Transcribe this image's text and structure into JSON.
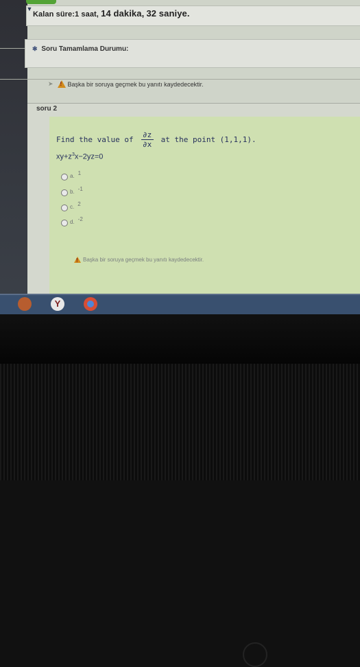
{
  "timer": {
    "label": "Kalan süre:1 saat,",
    "minutes": "14 dakika,",
    "seconds": "32 saniye."
  },
  "status": {
    "label": "Soru Tamamlama Durumu:"
  },
  "warning_top": {
    "text": "Başka bir soruya geçmek bu yanıtı kaydedecektir."
  },
  "question": {
    "label": "soru 2",
    "prefix": "Find the value of",
    "fraction_num": "∂z",
    "fraction_den": "∂x",
    "suffix": "at the point (1,1,1).",
    "equation_part1": "xy+z",
    "equation_exp": "3",
    "equation_part2": "x−2yz=0",
    "options": [
      {
        "letter": "a.",
        "value": "1"
      },
      {
        "letter": "b.",
        "value": "-1"
      },
      {
        "letter": "c.",
        "value": "2"
      },
      {
        "letter": "d.",
        "value": "-2"
      }
    ]
  },
  "warning_bottom": {
    "text": "Başka bir soruya geçmek bu yanıtı kaydedecektir."
  },
  "taskbar": {
    "icon1": "Y"
  }
}
